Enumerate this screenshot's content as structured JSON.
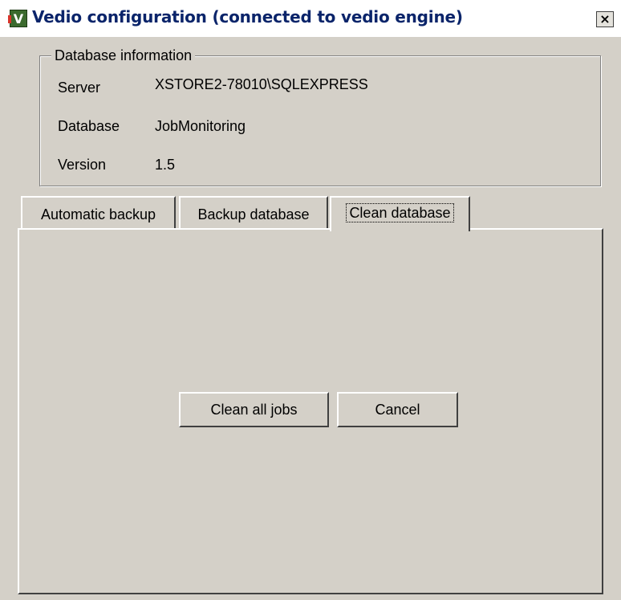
{
  "window": {
    "title": "Vedio configuration (connected to vedio engine)",
    "icon_letter": "V",
    "close_label": "×"
  },
  "database_info": {
    "legend": "Database information",
    "rows": [
      {
        "label": "Server",
        "value": "XSTORE2-78010\\SQLEXPRESS"
      },
      {
        "label": "Database",
        "value": "JobMonitoring"
      },
      {
        "label": "Version",
        "value": "1.5"
      }
    ]
  },
  "tabs": [
    {
      "label": "Automatic backup",
      "active": false
    },
    {
      "label": "Backup database",
      "active": false
    },
    {
      "label": "Clean database",
      "active": true
    }
  ],
  "clean_panel": {
    "clean_all_label": "Clean all jobs",
    "cancel_label": "Cancel"
  },
  "colors": {
    "face": "#d4d0c8",
    "title_text": "#0a246a",
    "title_bar": "#ffffff"
  }
}
